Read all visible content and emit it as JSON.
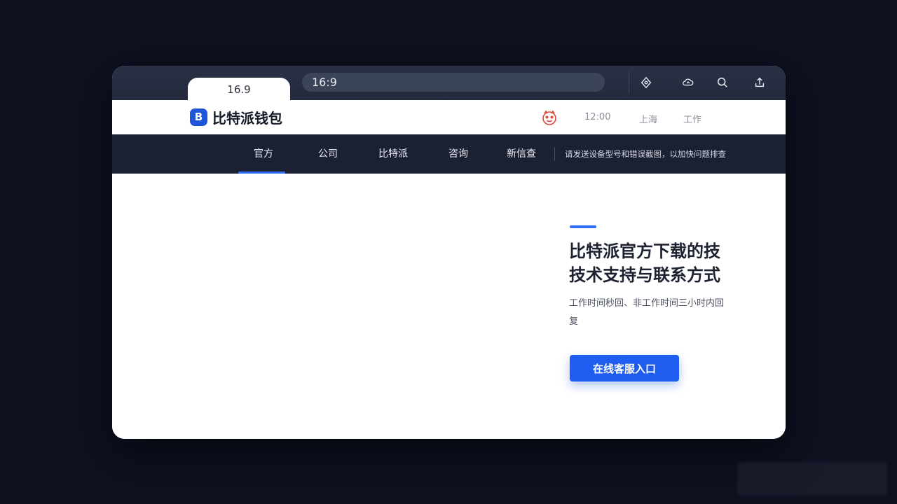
{
  "browser": {
    "tab_label": "16.9",
    "url": "16:9",
    "toolbar_icons": [
      "location-icon",
      "cloud-sync-icon",
      "search-icon",
      "share-icon"
    ]
  },
  "site": {
    "logo_letter": "B",
    "logo_text": "比特派钱包",
    "header_links": [
      "12:00",
      "上海",
      "工作"
    ]
  },
  "nav": {
    "items": [
      "官方",
      "公司",
      "比特派",
      "咨询",
      "新信查"
    ],
    "active_index": 0,
    "notice": "请发送设备型号和错误截图，以加快问题排查"
  },
  "hero": {
    "headline_line1": "比特派官方下载的技",
    "headline_line2": "技术支持与联系方式",
    "subtext": "工作时间秒回、非工作时间三小时内回复",
    "cta_label": "在线客服入口"
  },
  "colors": {
    "accent": "#2f6ef2",
    "button": "#1f5cf0",
    "nav_bg": "#1b2033",
    "chrome_bg": "#262c3e",
    "page_bg": "#0d1120"
  }
}
